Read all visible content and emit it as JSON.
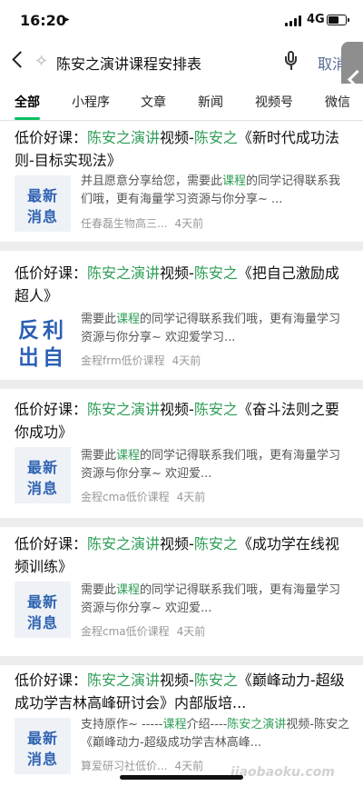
{
  "status": {
    "time": "16:20",
    "network": "4G",
    "battery_level": 0.7
  },
  "search": {
    "query": "陈安之演讲课程安排表",
    "cancel_label": "取消"
  },
  "tabs": [
    {
      "label": "全部",
      "active": true
    },
    {
      "label": "小程序",
      "active": false
    },
    {
      "label": "文章",
      "active": false
    },
    {
      "label": "新闻",
      "active": false
    },
    {
      "label": "视频号",
      "active": false
    },
    {
      "label": "微信",
      "active": false
    }
  ],
  "results": [
    {
      "title": {
        "p1": "低价好课：",
        "k1": "陈安之演讲",
        "p2": "视频-",
        "k2": "陈安之",
        "p3": "《新时代成功法则-目标实现法》"
      },
      "thumb": {
        "line1": "最新",
        "line2": "消息"
      },
      "snippet": {
        "s1": "并且愿意分享给您，需要此",
        "k1": "课程",
        "s2": "的同学记得联系我们哦，更有海量学习资源与你分享~ ...",
        "k2": "",
        "s3": ""
      },
      "source": "任春磊生物高三...",
      "time": "4天前"
    },
    {
      "title": {
        "p1": "低价好课：",
        "k1": "陈安之演讲",
        "p2": "视频-",
        "k2": "陈安之",
        "p3": "《把自己激励成超人》"
      },
      "thumb": {
        "line1": "反利",
        "line2": "岀自"
      },
      "snippet": {
        "s1": "需要此",
        "k1": "课程",
        "s2": "的同学记得联系我们哦，更有海量学习资源与你分享~ 欢迎爱学习...",
        "k2": "",
        "s3": ""
      },
      "source": "金程frm低价课程",
      "time": "4天前"
    },
    {
      "title": {
        "p1": "低价好课：",
        "k1": "陈安之演讲",
        "p2": "视频-",
        "k2": "陈安之",
        "p3": "《奋斗法则之要你成功》"
      },
      "thumb": {
        "line1": "最新",
        "line2": "消息"
      },
      "snippet": {
        "s1": "需要此",
        "k1": "课程",
        "s2": "的同学记得联系我们哦，更有海量学习资源与你分享~ 欢迎爱...",
        "k2": "",
        "s3": ""
      },
      "source": "金程cma低价课程",
      "time": "4天前"
    },
    {
      "title": {
        "p1": "低价好课：",
        "k1": "陈安之演讲",
        "p2": "视频-",
        "k2": "陈安之",
        "p3": "《成功学在线视频训练》"
      },
      "thumb": {
        "line1": "最新",
        "line2": "消息"
      },
      "snippet": {
        "s1": "需要此",
        "k1": "课程",
        "s2": "的同学记得联系我们哦，更有海量学习资源与你分享~ 欢迎爱...",
        "k2": "",
        "s3": ""
      },
      "source": "金程cma低价课程",
      "time": "4天前"
    },
    {
      "title": {
        "p1": "低价好课：",
        "k1": "陈安之演讲",
        "p2": "视频-",
        "k2": "陈安之",
        "p3": "《巅峰动力-超级成功学吉林高峰研讨会》内部版培..."
      },
      "thumb": {
        "line1": "最新",
        "line2": "消息"
      },
      "snippet": {
        "s1": "支持原作~ -----",
        "k1": "课程",
        "s2": "介绍----",
        "k2": "陈安之演讲",
        "s3": "视频-陈安之《巅峰动力-超级成功学吉林高峰..."
      },
      "source": "算爱研习社低价...",
      "time": "4天前"
    }
  ],
  "watermark": "jiaobaoku.com",
  "colors": {
    "highlight": "#2e9e57",
    "tab_underline": "#07c160",
    "cancel": "#576b95"
  }
}
